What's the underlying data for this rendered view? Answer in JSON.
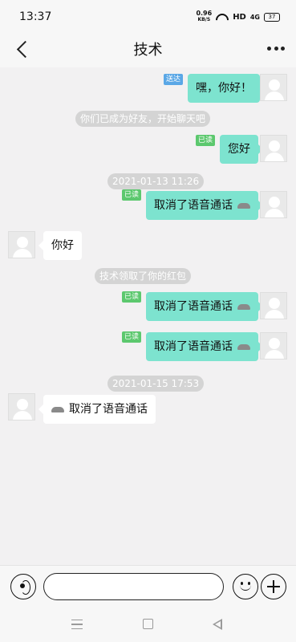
{
  "status_bar": {
    "time": "13:37",
    "net_speed": "0.96",
    "net_speed_unit": "KB/S",
    "hd": "HD",
    "signal": "4G",
    "battery": "37"
  },
  "header": {
    "title": "技术"
  },
  "messages": [
    {
      "kind": "out",
      "tag": "送达",
      "tag_type": "sent",
      "text": "嘿，你好！"
    },
    {
      "kind": "system",
      "text": "你们已成为好友，开始聊天吧"
    },
    {
      "kind": "out",
      "tag": "已读",
      "tag_type": "read",
      "text": "您好"
    },
    {
      "kind": "time",
      "text": "2021-01-13 11:26"
    },
    {
      "kind": "out",
      "tag": "已读",
      "tag_type": "read",
      "text": "取消了语音通话",
      "icon": "phone-hangup-icon"
    },
    {
      "kind": "in",
      "text": "你好"
    },
    {
      "kind": "system",
      "text": "技术领取了你的红包"
    },
    {
      "kind": "out",
      "tag": "已读",
      "tag_type": "read",
      "text": "取消了语音通话",
      "icon": "phone-hangup-icon"
    },
    {
      "kind": "out",
      "tag": "已读",
      "tag_type": "read",
      "text": "取消了语音通话",
      "icon": "phone-hangup-icon"
    },
    {
      "kind": "time",
      "text": "2021-01-15 17:53"
    },
    {
      "kind": "in",
      "text": "取消了语音通话",
      "icon": "phone-hangup-icon"
    }
  ],
  "input_bar": {
    "placeholder": "",
    "value": ""
  },
  "colors": {
    "outgoing_bubble": "#7de3cf",
    "incoming_bubble": "#ffffff",
    "read_tag": "#5cc86e",
    "sent_tag": "#5aa7e6",
    "system_pill": "#d4d4d4",
    "chat_background": "#f2f1f2"
  }
}
